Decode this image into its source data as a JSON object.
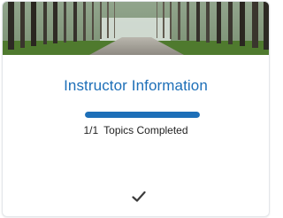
{
  "card": {
    "image": "forest-road-banner",
    "title": "Instructor Information",
    "progress": {
      "completed": "1/1",
      "label": "Topics Completed",
      "fraction": 1.0
    },
    "status_icon": "checkmark-icon"
  },
  "colors": {
    "accent": "#1d6fb8",
    "track": "#d5dbe1",
    "text": "#222222"
  }
}
